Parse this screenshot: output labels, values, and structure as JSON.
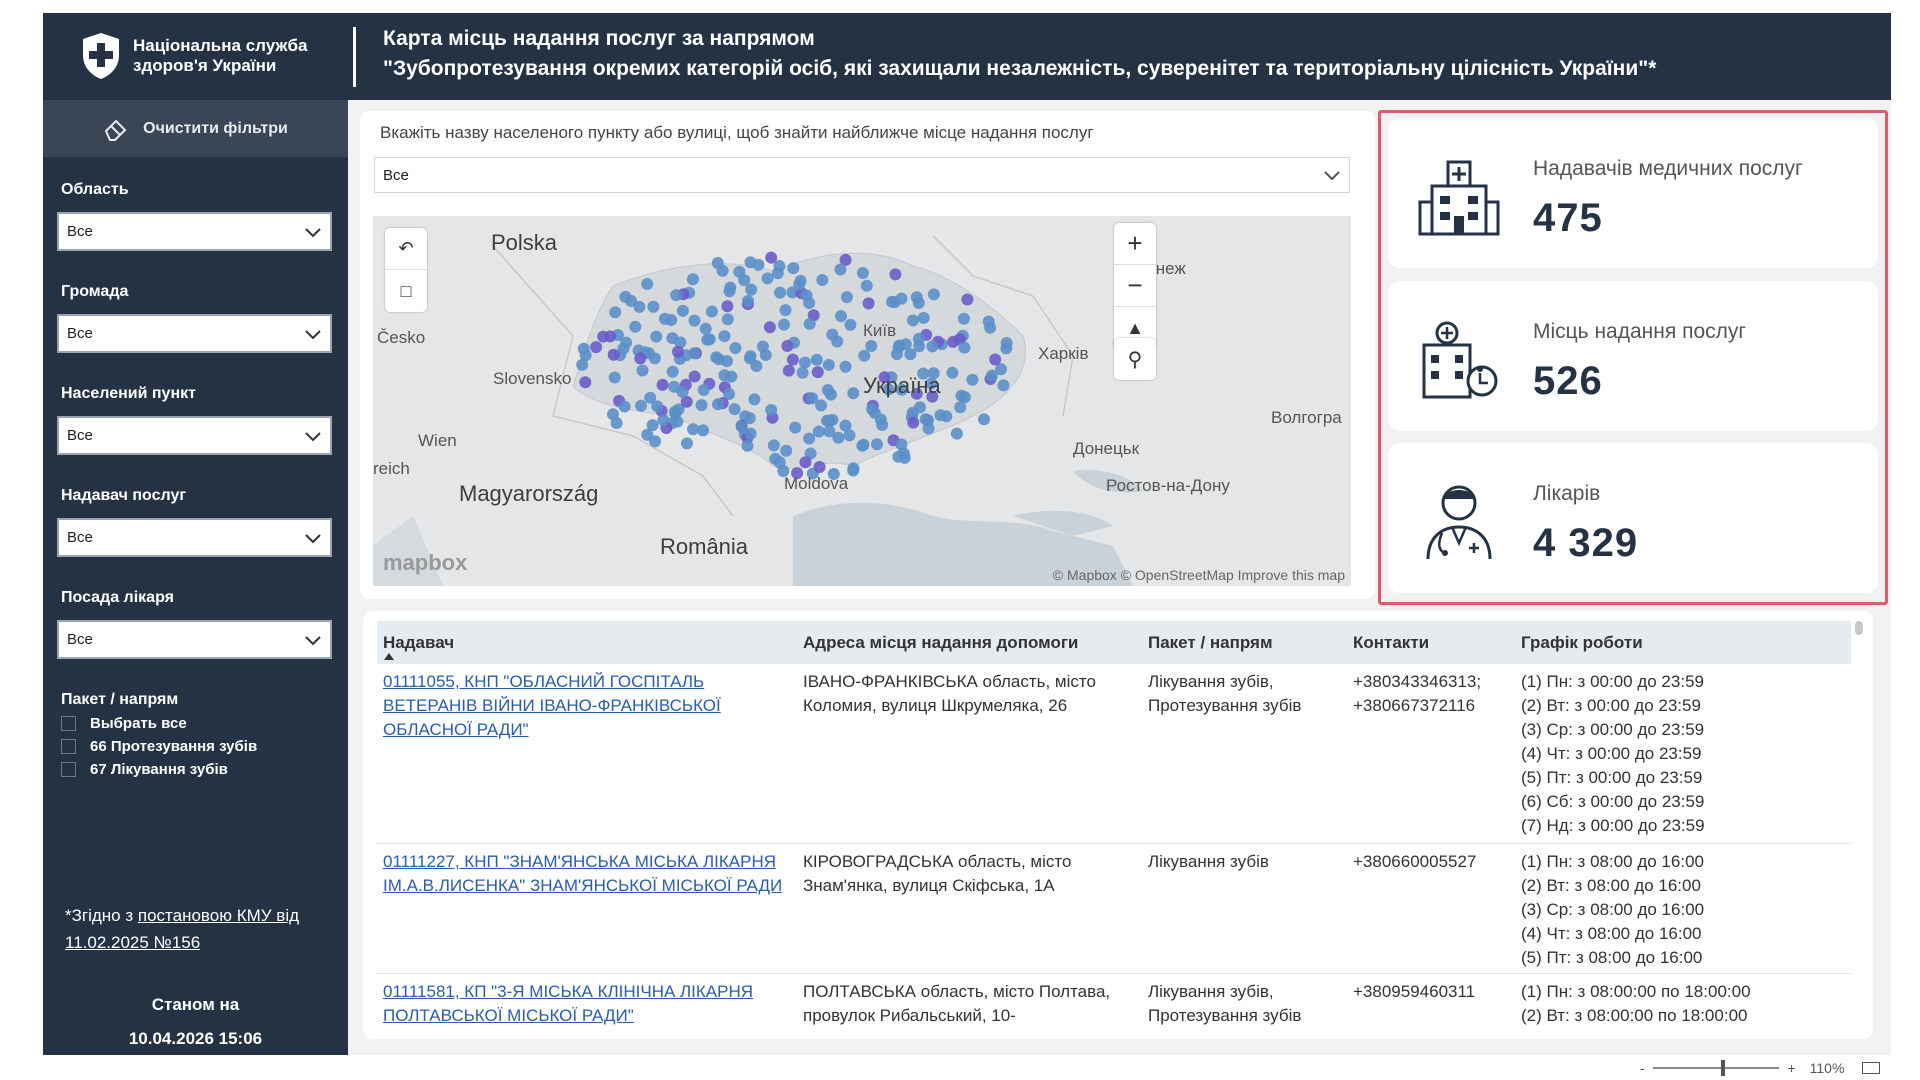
{
  "header": {
    "org_name": "Національна служба здоров'я України",
    "title_line1": "Карта місць надання послуг за напрямом",
    "title_line2": "\"Зубопротезування окремих категорій осіб, які захищали незалежність, суверенітет та територіальну цілісність України\"*"
  },
  "sidebar": {
    "clear_filters": "Очистити фільтри",
    "filters": [
      {
        "label": "Область",
        "value": "Все"
      },
      {
        "label": "Громада",
        "value": "Все"
      },
      {
        "label": "Населений пункт",
        "value": "Все"
      },
      {
        "label": "Надавач послуг",
        "value": "Все"
      },
      {
        "label": "Посада лікаря",
        "value": "Все"
      }
    ],
    "package_label": "Пакет / напрям",
    "package_options": [
      "Выбрать все",
      "66 Протезування зубів",
      "67 Лікування зубів"
    ],
    "note_prefix": "*Згідно з ",
    "note_link": "постановою КМУ від 11.02.2025 №156",
    "asof_label": "Станом на",
    "asof_value": "10.04.2026 15:06"
  },
  "search": {
    "label": "Вкажіть назву населеного пункту або вулиці, щоб знайти найближче місце надання послуг",
    "value": "Все"
  },
  "map": {
    "labels": [
      "Polska",
      "Česko",
      "Slovensko",
      "Wien",
      "reich",
      "Magyarország",
      "Moldova",
      "România",
      "Київ",
      "Україна",
      "Харків",
      "Воронеж",
      "Волгогра",
      "Донецьк",
      "Ростов-на-Дону"
    ],
    "attribution": "© Mapbox © OpenStreetMap  Improve this map",
    "logo": "mapbox",
    "dot_color": "#5b8fc9",
    "dot_color_alt": "#6a5cc9"
  },
  "kpis": [
    {
      "label": "Надавачів медичних послуг",
      "value": "475",
      "icon": "hospital-icon"
    },
    {
      "label": "Місць надання послуг",
      "value": "526",
      "icon": "clinic-accessible-icon"
    },
    {
      "label": "Лікарів",
      "value": "4 329",
      "icon": "doctor-icon"
    }
  ],
  "table": {
    "columns": [
      "Надавач",
      "Адреса місця надання допомоги",
      "Пакет / напрям",
      "Контакти",
      "Графік роботи"
    ],
    "rows": [
      {
        "provider": "01111055, КНП \"ОБЛАСНИЙ ГОСПІТАЛЬ ВЕТЕРАНІВ ВІЙНИ ІВАНО-ФРАНКІВСЬКОЇ ОБЛАСНОЇ РАДИ\"",
        "address": "ІВАНО-ФРАНКІВСЬКА область, місто Коломия, вулиця Шкрумеляка, 26",
        "package": "Лікування зубів, Протезування зубів",
        "contacts": "+380343346313; +380667372116",
        "schedule": [
          "(1) Пн: з 00:00 до 23:59",
          "(2) Вт: з 00:00 до 23:59",
          "(3) Ср: з 00:00 до 23:59",
          "(4) Чт: з 00:00 до 23:59",
          "(5) Пт: з 00:00 до 23:59",
          "(6) Сб: з 00:00 до 23:59",
          "(7) Нд: з 00:00 до 23:59"
        ]
      },
      {
        "provider": "01111227, КНП \"ЗНАМ'ЯНСЬКА МІСЬКА ЛІКАРНЯ ІМ.А.В.ЛИСЕНКА\" ЗНАМ'ЯНСЬКОЇ МІСЬКОЇ РАДИ",
        "address": "КІРОВОГРАДСЬКА область, місто Знам'янка, вулиця Скіфська, 1А",
        "package": "Лікування зубів",
        "contacts": "+380660005527",
        "schedule": [
          "(1) Пн: з 08:00 до 16:00",
          "(2) Вт: з 08:00 до 16:00",
          "(3) Ср: з 08:00 до 16:00",
          "(4) Чт: з 08:00 до 16:00",
          "(5) Пт: з 08:00 до 16:00"
        ]
      },
      {
        "provider": "01111581, КП \"3-Я МІСЬКА КЛІНІЧНА ЛІКАРНЯ ПОЛТАВСЬКОЇ МІСЬКОЇ РАДИ\"",
        "address": "ПОЛТАВСЬКА область, місто Полтава, провулок Рибальський, 10-",
        "package": "Лікування зубів, Протезування зубів",
        "contacts": "+380959460311",
        "schedule": [
          "(1) Пн: з 08:00:00 по 18:00:00",
          "(2) Вт: з 08:00:00 по 18:00:00"
        ]
      }
    ]
  },
  "statusbar": {
    "zoom_minus": "-",
    "zoom_plus": "+",
    "zoom_level": "110%"
  }
}
